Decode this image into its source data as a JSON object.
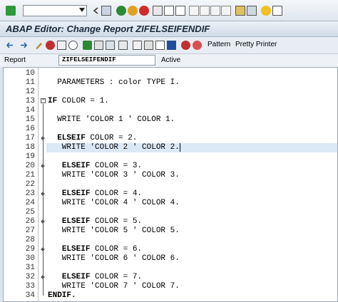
{
  "toolbar": {
    "command_field": ""
  },
  "window": {
    "title": "ABAP Editor: Change Report ZIFELSEIFENDIF"
  },
  "app_toolbar": {
    "pattern_label": "Pattern",
    "pretty_printer_label": "Pretty Printer"
  },
  "report": {
    "label": "Report",
    "name": "ZIFELSEIFENDIF",
    "status": "Active"
  },
  "editor": {
    "lines": [
      {
        "num": "10",
        "text": ""
      },
      {
        "num": "11",
        "text": "  PARAMETERS : color TYPE I."
      },
      {
        "num": "12",
        "text": ""
      },
      {
        "num": "13",
        "text": "IF COLOR = 1."
      },
      {
        "num": "14",
        "text": ""
      },
      {
        "num": "15",
        "text": "  WRITE 'COLOR 1 ' COLOR 1."
      },
      {
        "num": "16",
        "text": ""
      },
      {
        "num": "17",
        "text": "  ELSEIF COLOR = 2."
      },
      {
        "num": "18",
        "text": "   WRITE 'COLOR 2 ' COLOR 2."
      },
      {
        "num": "19",
        "text": ""
      },
      {
        "num": "20",
        "text": "   ELSEIF COLOR = 3."
      },
      {
        "num": "21",
        "text": "   WRITE 'COLOR 3 ' COLOR 3."
      },
      {
        "num": "22",
        "text": ""
      },
      {
        "num": "23",
        "text": "   ELSEIF COLOR = 4."
      },
      {
        "num": "24",
        "text": "   WRITE 'COLOR 4 ' COLOR 4."
      },
      {
        "num": "25",
        "text": ""
      },
      {
        "num": "26",
        "text": "   ELSEIF COLOR = 5."
      },
      {
        "num": "27",
        "text": "   WRITE 'COLOR 5 ' COLOR 5."
      },
      {
        "num": "28",
        "text": ""
      },
      {
        "num": "29",
        "text": "   ELSEIF COLOR = 6."
      },
      {
        "num": "30",
        "text": "   WRITE 'COLOR 6 ' COLOR 6."
      },
      {
        "num": "31",
        "text": ""
      },
      {
        "num": "32",
        "text": "   ELSEIF COLOR = 7."
      },
      {
        "num": "33",
        "text": "   WRITE 'COLOR 7 ' COLOR 7."
      },
      {
        "num": "34",
        "text": "ENDIF."
      }
    ]
  },
  "colors": {
    "keyword": "#000000",
    "highlight": "#dbe8f5",
    "title_bg": "#cfdbe8"
  }
}
